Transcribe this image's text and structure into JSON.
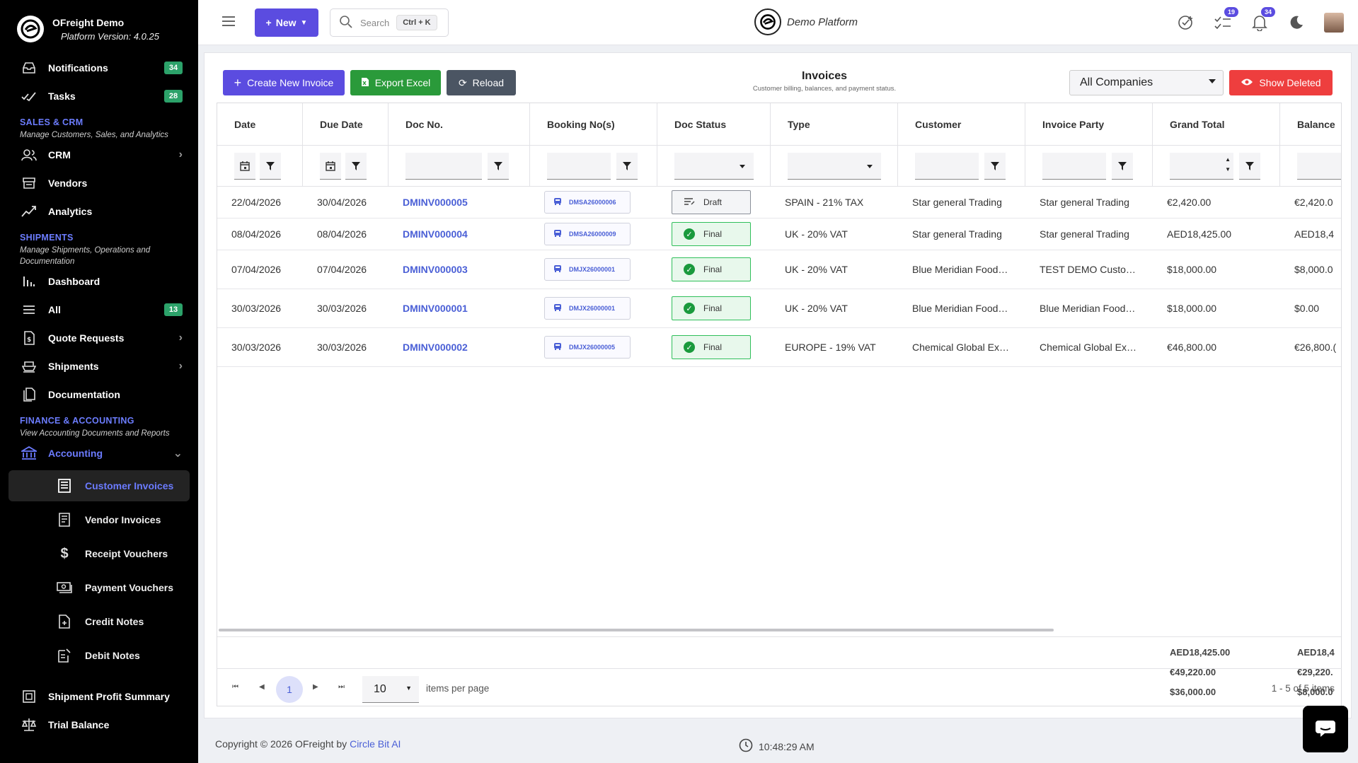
{
  "app": {
    "name": "OFreight Demo",
    "version": "Platform Version: 4.0.25"
  },
  "sidebar": {
    "top_items": [
      {
        "label": "Notifications",
        "badge": "34",
        "icon": "inbox-icon"
      },
      {
        "label": "Tasks",
        "badge": "28",
        "icon": "check-list-icon"
      }
    ],
    "sales": {
      "title": "SALES & CRM",
      "subtitle": "Manage Customers, Sales, and Analytics",
      "items": [
        {
          "label": "CRM",
          "icon": "users-icon"
        },
        {
          "label": "Vendors",
          "icon": "store-icon"
        },
        {
          "label": "Analytics",
          "icon": "trend-icon"
        }
      ]
    },
    "shipments": {
      "title": "SHIPMENTS",
      "subtitle": "Manage Shipments, Operations and Documentation",
      "items": [
        {
          "label": "Dashboard",
          "icon": "bar-chart-icon"
        },
        {
          "label": "All",
          "badge": "13",
          "icon": "list-icon"
        },
        {
          "label": "Quote Requests",
          "icon": "dollar-doc-icon"
        },
        {
          "label": "Shipments",
          "icon": "ship-icon"
        },
        {
          "label": "Documentation",
          "icon": "docs-icon"
        }
      ]
    },
    "finance": {
      "title": "FINANCE & ACCOUNTING",
      "subtitle": "View Accounting Documents and Reports",
      "accounting_label": "Accounting",
      "sub_items": [
        {
          "label": "Customer Invoices"
        },
        {
          "label": "Vendor Invoices"
        },
        {
          "label": "Receipt Vouchers"
        },
        {
          "label": "Payment Vouchers"
        },
        {
          "label": "Credit Notes"
        },
        {
          "label": "Debit Notes"
        }
      ],
      "bottom_items": [
        {
          "label": "Shipment Profit Summary"
        },
        {
          "label": "Trial Balance"
        }
      ]
    }
  },
  "topbar": {
    "new_label": "New",
    "search_placeholder": "Search",
    "search_shortcut": "Ctrl + K",
    "platform_name": "Demo Platform",
    "tasks_badge": "19",
    "notifications_badge": "34"
  },
  "toolbar": {
    "create_label": "Create New Invoice",
    "export_label": "Export Excel",
    "reload_label": "Reload",
    "title": "Invoices",
    "subtitle": "Customer billing, balances, and payment status.",
    "company_selected": "All Companies",
    "show_deleted_label": "Show Deleted"
  },
  "table": {
    "columns": [
      "Date",
      "Due Date",
      "Doc No.",
      "Booking No(s)",
      "Doc Status",
      "Type",
      "Customer",
      "Invoice Party",
      "Grand Total",
      "Balance"
    ],
    "rows": [
      {
        "date": "22/04/2026",
        "due": "30/04/2026",
        "doc": "DMINV000005",
        "booking": "DMSA26000006",
        "status": "Draft",
        "type": "SPAIN - 21% TAX",
        "customer": "Star general Trading",
        "party": "Star general Trading",
        "total": "€2,420.00",
        "balance": "€2,420.0"
      },
      {
        "date": "08/04/2026",
        "due": "08/04/2026",
        "doc": "DMINV000004",
        "booking": "DMSA26000009",
        "status": "Final",
        "type": "UK - 20% VAT",
        "customer": "Star general Trading",
        "party": "Star general Trading",
        "total": "AED18,425.00",
        "balance": "AED18,4"
      },
      {
        "date": "07/04/2026",
        "due": "07/04/2026",
        "doc": "DMINV000003",
        "booking": "DMJX26000001",
        "status": "Final",
        "type": "UK - 20% VAT",
        "customer": "Blue Meridian Food…",
        "party": "TEST DEMO Custo…",
        "total": "$18,000.00",
        "balance": "$8,000.0"
      },
      {
        "date": "30/03/2026",
        "due": "30/03/2026",
        "doc": "DMINV000001",
        "booking": "DMJX26000001",
        "status": "Final",
        "type": "UK - 20% VAT",
        "customer": "Blue Meridian Food…",
        "party": "Blue Meridian Food…",
        "total": "$18,000.00",
        "balance": "$0.00"
      },
      {
        "date": "30/03/2026",
        "due": "30/03/2026",
        "doc": "DMINV000002",
        "booking": "DMJX26000005",
        "status": "Final",
        "type": "EUROPE - 19% VAT",
        "customer": "Chemical Global Ex…",
        "party": "Chemical Global Ex…",
        "total": "€46,800.00",
        "balance": "€26,800.("
      }
    ],
    "totals": {
      "grand": [
        "AED18,425.00",
        "€49,220.00",
        "$36,000.00"
      ],
      "balance": [
        "AED18,4",
        "€29,220.",
        "$8,000.0"
      ]
    }
  },
  "pager": {
    "current_page": "1",
    "page_size": "10",
    "items_per_page_label": "items per page",
    "range_text": "1 - 5 of 5 items"
  },
  "footer": {
    "copyright": "Copyright © 2026 OFreight by ",
    "company_link": "Circle Bit AI",
    "time": "10:48:29 AM"
  },
  "colors": {
    "accent": "#5b4ce0",
    "export": "#2a9a3a",
    "reload": "#4b5563",
    "danger": "#ee3e3e",
    "link": "#4a5fd6",
    "final_green": "#1a9a3d"
  }
}
